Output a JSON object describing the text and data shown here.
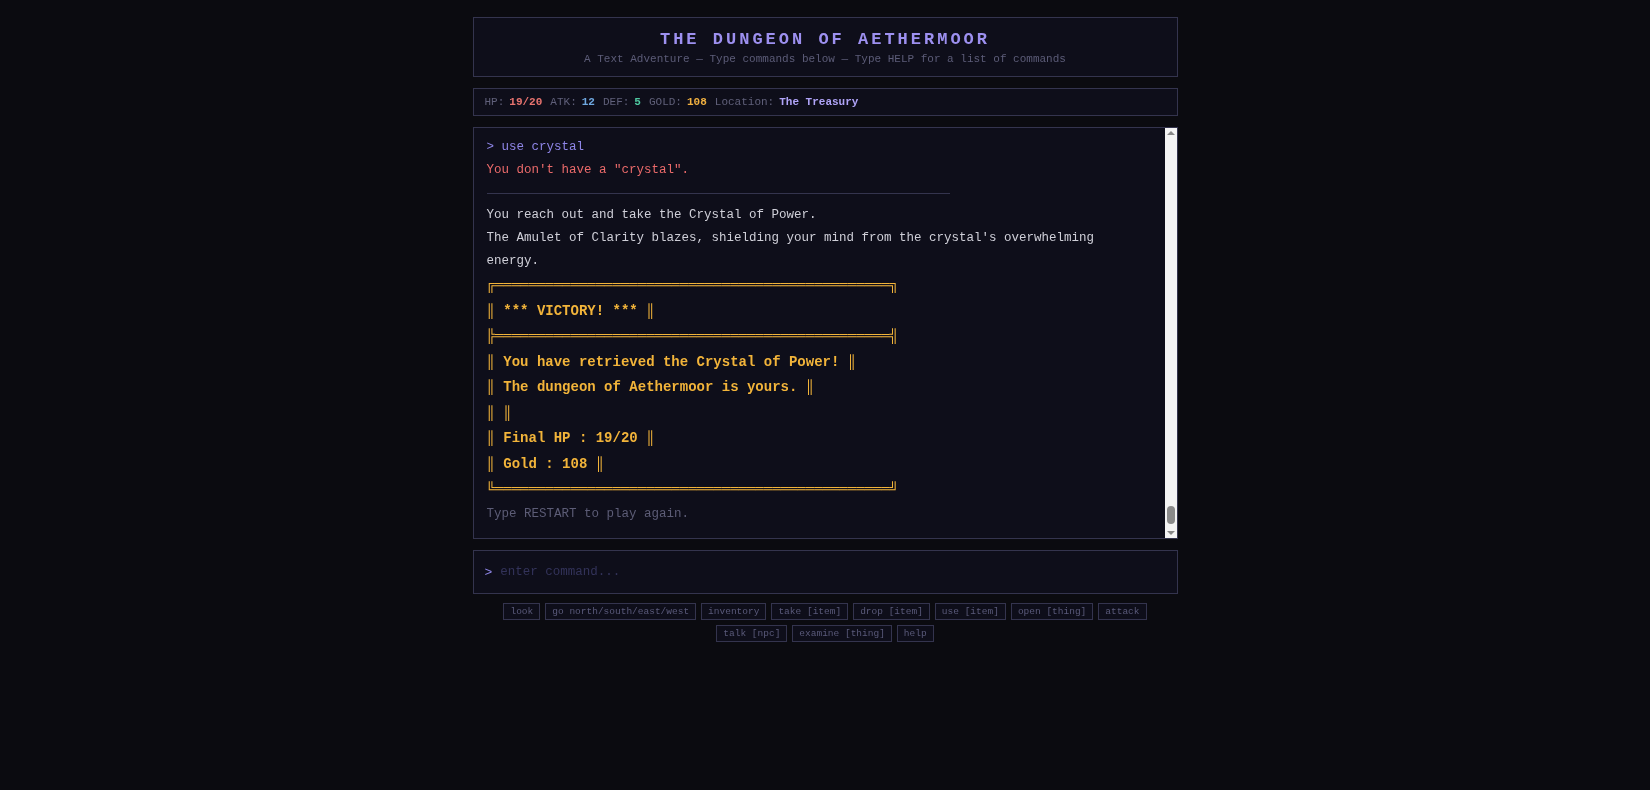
{
  "header": {
    "title": "THE DUNGEON OF AETHERMOOR",
    "subtitle": "A Text Adventure — Type commands below — Type HELP for a list of commands"
  },
  "stats": [
    {
      "label": "HP:",
      "value": "19/20",
      "color": "#e8736f"
    },
    {
      "label": "ATK:",
      "value": "12",
      "color": "#6fa8e0"
    },
    {
      "label": "DEF:",
      "value": "5",
      "color": "#4ec9a0"
    },
    {
      "label": "GOLD:",
      "value": "108",
      "color": "#f0b040"
    },
    {
      "label": "Location:",
      "value": "The Treasury",
      "color": "#b0a4f8"
    }
  ],
  "log": [
    {
      "kind": "command",
      "text": "> use crystal"
    },
    {
      "kind": "error",
      "text": "You don't have a \"crystal\"."
    },
    {
      "kind": "rule"
    },
    {
      "kind": "text",
      "text": "You reach out and take the Crystal of Power."
    },
    {
      "kind": "text",
      "text": "The Amulet of Clarity blazes, shielding your mind from the crystal's overwhelming energy."
    },
    {
      "kind": "banner",
      "text": "╔═══════════════════════════════════════════════╗"
    },
    {
      "kind": "banner",
      "text": "║ *** VICTORY! *** ║"
    },
    {
      "kind": "banner",
      "text": "╠═══════════════════════════════════════════════╣"
    },
    {
      "kind": "banner",
      "text": "║ You have retrieved the Crystal of Power! ║"
    },
    {
      "kind": "banner",
      "text": "║ The dungeon of Aethermoor is yours. ║"
    },
    {
      "kind": "banner",
      "text": "║ ║"
    },
    {
      "kind": "banner",
      "text": "║ Final HP : 19/20 ║"
    },
    {
      "kind": "banner",
      "text": "║ Gold : 108 ║"
    },
    {
      "kind": "banner",
      "text": "╚═══════════════════════════════════════════════╝"
    },
    {
      "kind": "hint",
      "text": "Type RESTART to play again."
    }
  ],
  "input": {
    "prompt": ">",
    "placeholder": "enter command..."
  },
  "commands": [
    [
      "look",
      "go north/south/east/west",
      "inventory",
      "take [item]",
      "drop [item]",
      "use [item]",
      "open [thing]",
      "attack"
    ],
    [
      "talk [npc]",
      "examine [thing]",
      "help"
    ]
  ]
}
